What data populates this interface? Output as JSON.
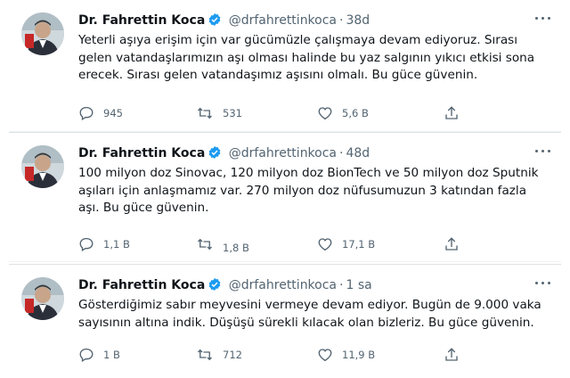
{
  "tweets": [
    {
      "name": "Dr. Fahrettin Koca",
      "handle": "@drfahrettinkoca",
      "separator": "·",
      "time": "38d",
      "text": "Yeterli aşıya erişim için var gücümüzle çalışmaya devam ediyoruz. Sırası gelen vatandaşlarımızın aşı olması halinde bu yaz salgının yıkıcı etkisi sona erecek. Sırası gelen vatandaşımız aşısını olmalı. Bu güce güvenin.",
      "replies": "945",
      "retweets": "531",
      "likes": "5,6 B"
    },
    {
      "name": "Dr. Fahrettin Koca",
      "handle": "@drfahrettinkoca",
      "separator": "·",
      "time": "48d",
      "text": "100 milyon doz Sinovac, 120 milyon doz BionTech ve 50 milyon doz Sputnik aşıları için anlaşmamız var. 270 milyon doz nüfusumuzun 3 katından fazla aşı. Bu güce güvenin.",
      "replies": "1,1 B",
      "retweets": "1,8 B",
      "likes": "17,1 B"
    },
    {
      "name": "Dr. Fahrettin Koca",
      "handle": "@drfahrettinkoca",
      "separator": "·",
      "time": "1 sa",
      "text": "Gösterdiğimiz sabır meyvesini vermeye devam ediyor. Bugün de 9.000 vaka sayısının altına indik. Düşüşü sürekli kılacak olan bizleriz. Bu güce güvenin.",
      "replies": "1 B",
      "retweets": "712",
      "likes": "11,9 B"
    }
  ],
  "colors": {
    "verified": "#1d9bf0",
    "muted": "#536471",
    "text": "#0f1419"
  }
}
